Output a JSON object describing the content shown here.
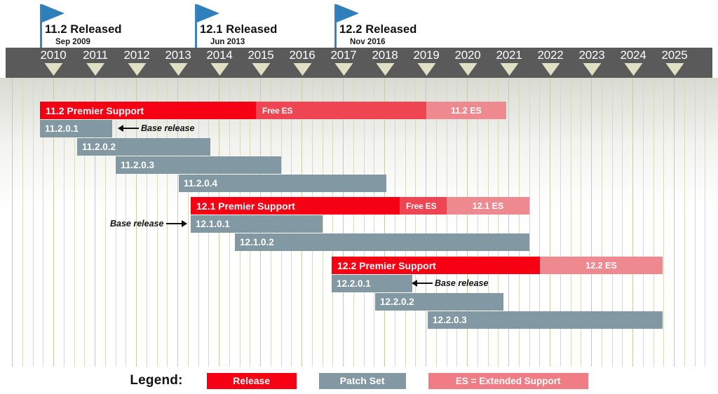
{
  "chart_data": {
    "type": "bar",
    "title": "Oracle Database Release Support Timeline",
    "xlabel": "",
    "ylabel": "",
    "xlim": [
      2009.6,
      2026.0
    ],
    "grid": true,
    "legend_position": "bottom-center",
    "axis_years": [
      "2010",
      "2011",
      "2012",
      "2013",
      "2014",
      "2015",
      "2016",
      "2017",
      "2018",
      "2019",
      "2020",
      "2021",
      "2022",
      "2023",
      "2024",
      "2025"
    ],
    "milestones": [
      {
        "title": "11.2 Released",
        "date": "Sep 2009",
        "x_year": 2009.7
      },
      {
        "title": "12.1 Released",
        "date": "Jun 2013",
        "x_year": 2013.45
      },
      {
        "title": "12.2 Released",
        "date": "Nov 2016",
        "x_year": 2016.85
      }
    ],
    "series": [
      {
        "name": "11.2 Premier Support",
        "kind": "release",
        "segments": [
          {
            "label": "11.2 Premier Support",
            "type": "premier",
            "start": 2009.83,
            "end": 2015.08
          },
          {
            "label": "Free ES",
            "type": "free-es",
            "start": 2015.08,
            "end": 2019.23
          },
          {
            "label": "11.2 ES",
            "type": "es",
            "start": 2019.23,
            "end": 2021.18
          }
        ]
      },
      {
        "name": "11.2.0.1",
        "kind": "patch",
        "label": "11.2.0.1",
        "start": 2009.83,
        "end": 2011.59
      },
      {
        "name": "11.2.0.2",
        "kind": "patch",
        "label": "11.2.0.2",
        "start": 2010.73,
        "end": 2013.98
      },
      {
        "name": "11.2.0.3",
        "kind": "patch",
        "label": "11.2.0.3",
        "start": 2011.67,
        "end": 2015.68
      },
      {
        "name": "11.2.0.4",
        "kind": "patch",
        "label": "11.2.0.4",
        "start": 2013.21,
        "end": 2018.24
      },
      {
        "name": "12.1 Premier Support",
        "kind": "release",
        "segments": [
          {
            "label": "12.1 Premier Support",
            "type": "premier",
            "start": 2013.5,
            "end": 2018.58
          },
          {
            "label": "Free ES",
            "type": "free-es",
            "start": 2018.58,
            "end": 2019.73
          },
          {
            "label": "12.1 ES",
            "type": "es",
            "start": 2019.73,
            "end": 2021.74
          }
        ]
      },
      {
        "name": "12.1.0.1",
        "kind": "patch",
        "label": "12.1.0.1",
        "start": 2013.5,
        "end": 2016.7
      },
      {
        "name": "12.1.0.2",
        "kind": "patch",
        "label": "12.1.0.2",
        "start": 2014.57,
        "end": 2021.74
      },
      {
        "name": "12.2 Premier Support",
        "kind": "release",
        "segments": [
          {
            "label": "12.2 Premier Support",
            "type": "premier",
            "start": 2016.93,
            "end": 2021.99
          },
          {
            "label": "12.2 ES",
            "type": "es",
            "start": 2021.99,
            "end": 2024.98
          }
        ]
      },
      {
        "name": "12.2.0.1",
        "kind": "patch",
        "label": "12.2.0.1",
        "start": 2016.93,
        "end": 2018.89
      },
      {
        "name": "12.2.0.2",
        "kind": "patch",
        "label": "12.2.0.2",
        "start": 2017.99,
        "end": 2021.11
      },
      {
        "name": "12.2.0.3",
        "kind": "patch",
        "label": "12.2.0.3",
        "start": 2019.27,
        "end": 2024.98
      }
    ],
    "annotations": [
      {
        "text": "Base release",
        "direction": "left",
        "target": "11.2.0.1"
      },
      {
        "text": "Base release",
        "direction": "right",
        "target": "12.1.0.1"
      },
      {
        "text": "Base release",
        "direction": "left",
        "target": "12.2.0.1"
      }
    ],
    "colors": {
      "premier": "#f60013",
      "free_es": "#ef4452",
      "extended_support": "#ee8a8f",
      "patch_set": "#8298a3",
      "axis_bar": "#5a5a5a",
      "year_marker": "#dfe0c4",
      "flag": "#2f7fba",
      "gridline": "#d8d9bd"
    }
  },
  "flags": [
    {
      "title": "11.2 Released",
      "date": "Sep 2009"
    },
    {
      "title": "12.1 Released",
      "date": "Jun 2013"
    },
    {
      "title": "12.2 Released",
      "date": "Nov 2016"
    }
  ],
  "axis": {
    "years": [
      "2010",
      "2011",
      "2012",
      "2013",
      "2014",
      "2015",
      "2016",
      "2017",
      "2018",
      "2019",
      "2020",
      "2021",
      "2022",
      "2023",
      "2024",
      "2025"
    ]
  },
  "rows": {
    "r0": {
      "s0": "11.2 Premier Support",
      "s1": "Free ES",
      "s2": "11.2 ES"
    },
    "r1": {
      "label": "11.2.0.1"
    },
    "r2": {
      "label": "11.2.0.2"
    },
    "r3": {
      "label": "11.2.0.3"
    },
    "r4": {
      "label": "11.2.0.4"
    },
    "r5": {
      "s0": "12.1 Premier Support",
      "s1": "Free ES",
      "s2": "12.1 ES"
    },
    "r6": {
      "label": "12.1.0.1"
    },
    "r7": {
      "label": "12.1.0.2"
    },
    "r8": {
      "s0": "12.2 Premier Support",
      "s1": "12.2 ES"
    },
    "r9": {
      "label": "12.2.0.1"
    },
    "r10": {
      "label": "12.2.0.2"
    },
    "r11": {
      "label": "12.2.0.3"
    }
  },
  "annotations": {
    "a1": "Base release",
    "a2": "Base release",
    "a3": "Base release"
  },
  "legend": {
    "title": "Legend:",
    "release": "Release",
    "patch_set": "Patch Set",
    "extended_support": "ES = Extended Support"
  }
}
